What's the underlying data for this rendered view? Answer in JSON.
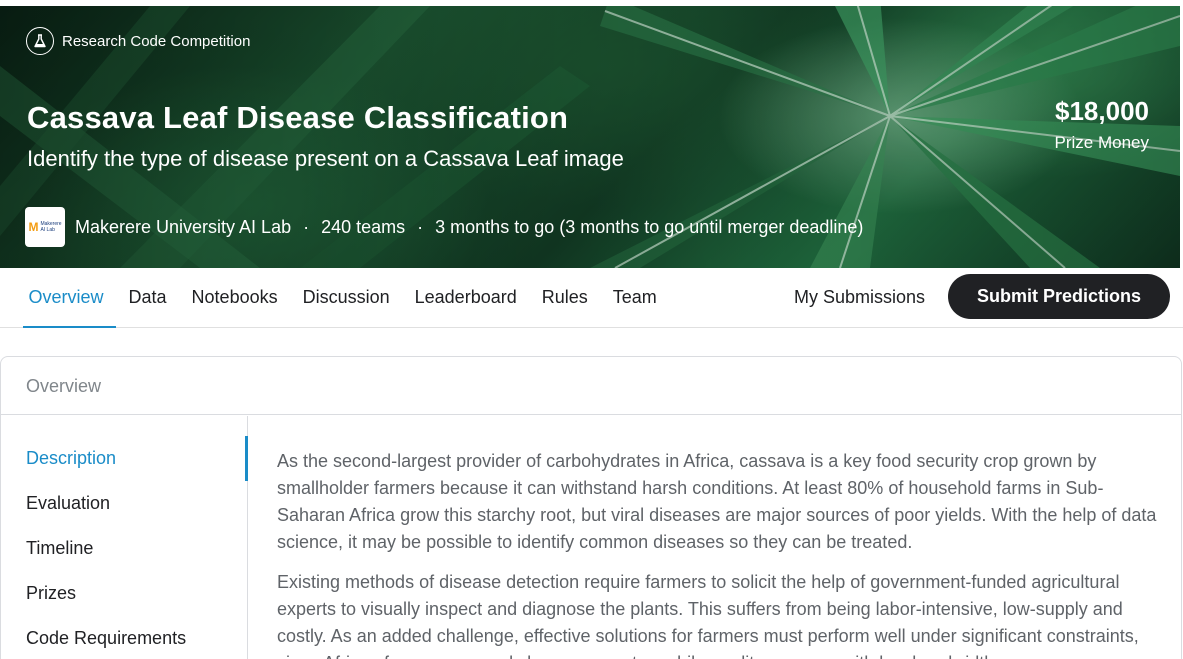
{
  "competition": {
    "type_label": "Research Code Competition",
    "title": "Cassava Leaf Disease Classification",
    "subtitle": "Identify the type of disease present on a Cassava Leaf image",
    "prize_amount": "$18,000",
    "prize_label": "Prize Money",
    "host": "Makerere University AI Lab",
    "teams": "240 teams",
    "deadline": "3 months to go (3 months to go until merger deadline)",
    "separator": "·"
  },
  "tabs": [
    {
      "label": "Overview",
      "active": true
    },
    {
      "label": "Data"
    },
    {
      "label": "Notebooks"
    },
    {
      "label": "Discussion"
    },
    {
      "label": "Leaderboard"
    },
    {
      "label": "Rules"
    },
    {
      "label": "Team"
    }
  ],
  "actions": {
    "my_submissions": "My Submissions",
    "submit": "Submit Predictions"
  },
  "overview": {
    "heading": "Overview",
    "nav": [
      {
        "label": "Description",
        "active": true
      },
      {
        "label": "Evaluation"
      },
      {
        "label": "Timeline"
      },
      {
        "label": "Prizes"
      },
      {
        "label": "Code Requirements"
      }
    ],
    "paragraphs": [
      "As the second-largest provider of carbohydrates in Africa, cassava is a key food security crop grown by smallholder farmers because it can withstand harsh conditions. At least 80% of household farms in Sub-Saharan Africa grow this starchy root, but viral diseases are major sources of poor yields. With the help of data science, it may be possible to identify common diseases so they can be treated.",
      "Existing methods of disease detection require farmers to solicit the help of government-funded agricultural experts to visually inspect and diagnose the plants. This suffers from being labor-intensive, low-supply and costly. As an added challenge, effective solutions for farmers must perform well under significant constraints, since African farmers may only have access to mobile-quality cameras with low-bandwidth."
    ]
  },
  "colors": {
    "accent": "#1a8cc8",
    "button_bg": "#202124",
    "text_muted": "#5f6368"
  }
}
